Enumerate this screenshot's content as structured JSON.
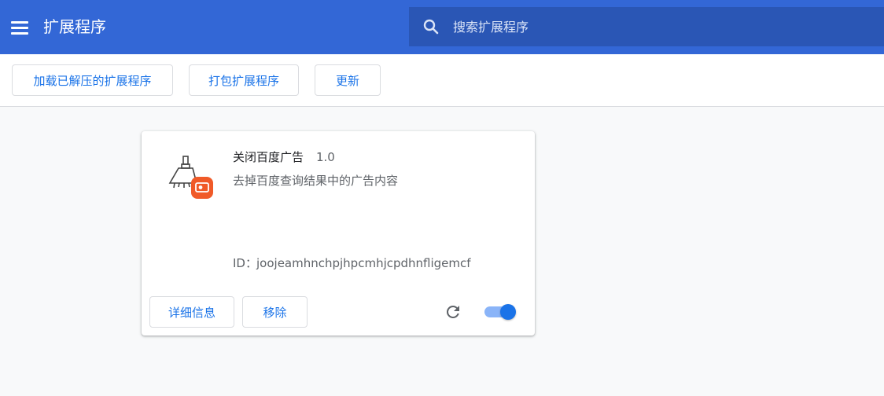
{
  "header": {
    "title": "扩展程序",
    "search_placeholder": "搜索扩展程序"
  },
  "toolbar": {
    "load_unpacked_label": "加载已解压的扩展程序",
    "pack_label": "打包扩展程序",
    "update_label": "更新"
  },
  "extension": {
    "name": "关闭百度广告",
    "version": "1.0",
    "description": "去掉百度查询结果中的广告内容",
    "id_label": "ID：",
    "id": "joojeamhnchpjhpcmhjcpdhnfligemcf",
    "details_label": "详细信息",
    "remove_label": "移除",
    "enabled": true,
    "icon": "broom-icon"
  },
  "colors": {
    "header_bg": "#3367d6",
    "search_bg": "#2a56b5",
    "accent": "#1a73e8",
    "badge": "#f05a28"
  }
}
